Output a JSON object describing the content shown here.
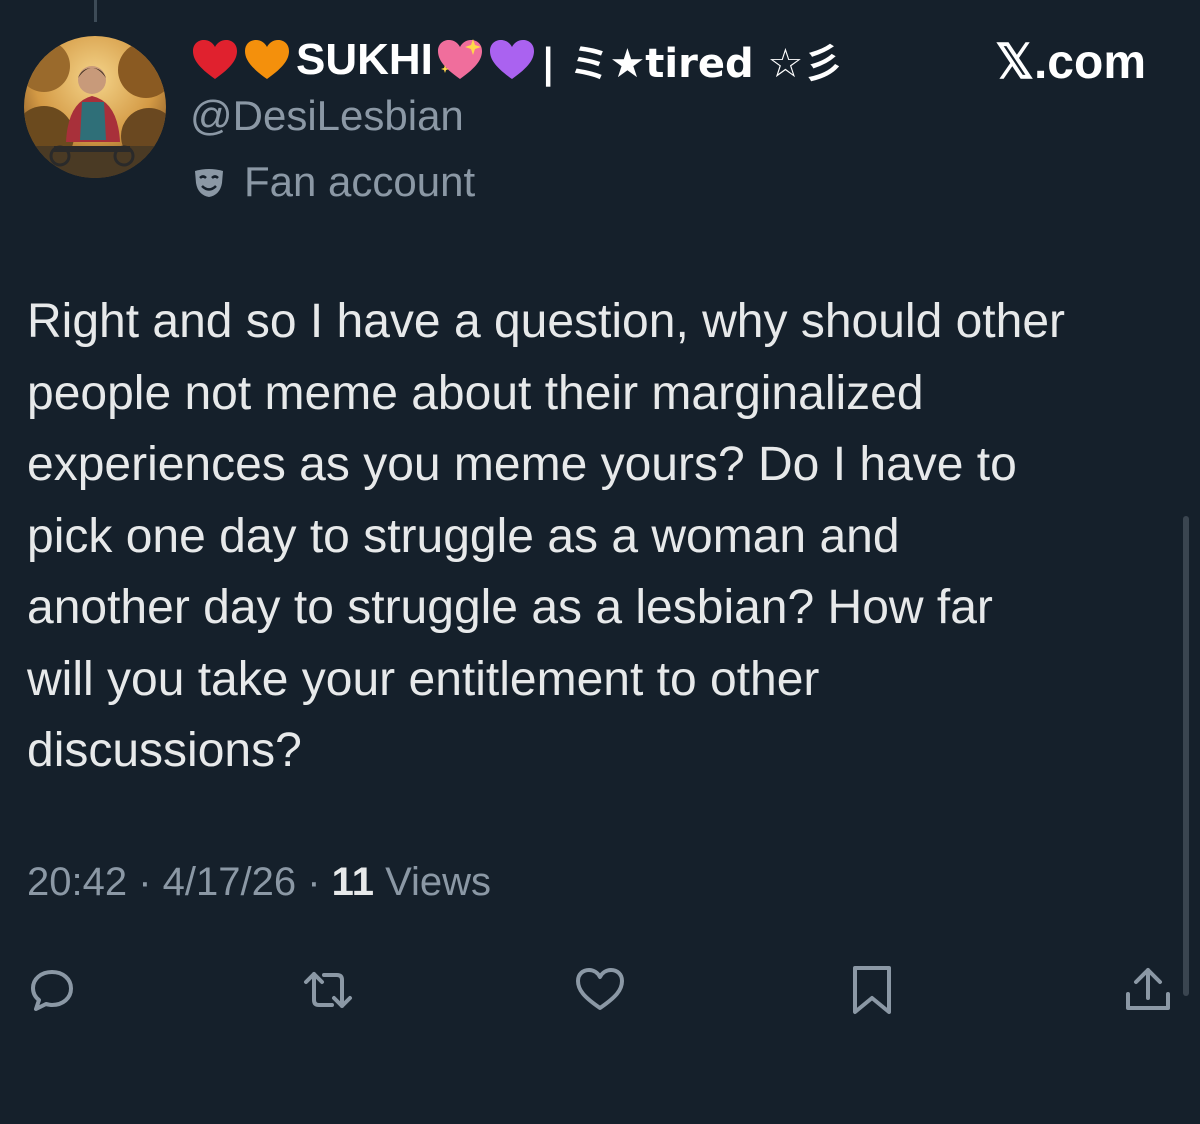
{
  "profile": {
    "display_name": "SUKHI",
    "name_suffix": "| ミ★tired ☆彡",
    "handle": "@DesiLesbian",
    "badge": "Fan account"
  },
  "site_label": "𝕏.com",
  "tweet": {
    "text": "Right and so I have a question, why should other\npeople not meme about their marginalized\nexperiences as you meme yours? Do I have to\npick one day to struggle as a woman and\nanother day to struggle as a lesbian? How far\nwill you take your entitlement to other\ndiscussions?"
  },
  "meta": {
    "time": "20:42",
    "sep1": " · ",
    "date": "4/17/26",
    "sep2": " · ",
    "views_count": "11",
    "views_label": " Views"
  },
  "actions": [
    {
      "icon": "reply-icon"
    },
    {
      "icon": "retweet-icon"
    },
    {
      "icon": "like-icon"
    },
    {
      "icon": "bookmark-icon"
    },
    {
      "icon": "share-icon"
    }
  ],
  "colors": {
    "background": "#15202b",
    "text_primary": "#e7e9ea",
    "text_secondary": "#8b98a5",
    "icon": "#8b98a5",
    "heart_red": "#e0212e",
    "heart_orange": "#f4900c",
    "heart_pink": "#f06e9c",
    "heart_purple": "#aa62f0"
  }
}
